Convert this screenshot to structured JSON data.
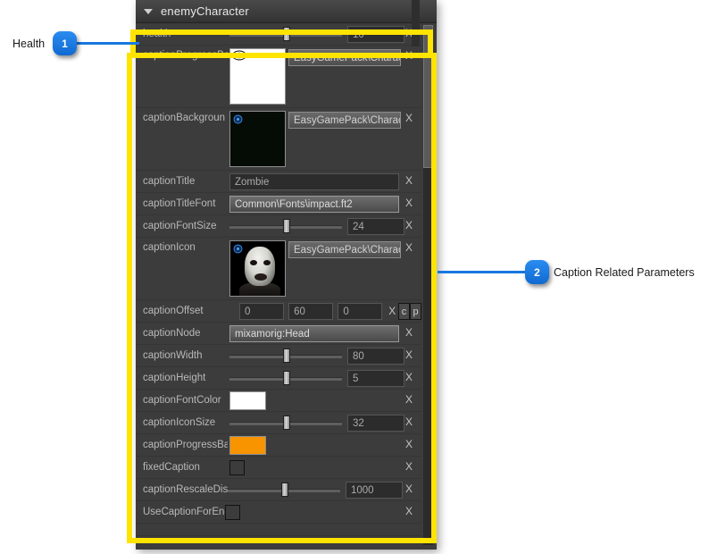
{
  "panel": {
    "title": "enemyCharacter",
    "collapse_icon": "triangle-down-icon",
    "rows": [
      {
        "id": "health",
        "label": "health",
        "type": "slider",
        "value": "10",
        "knob_pct": 48,
        "remove_label": "X"
      },
      {
        "id": "captionProgressBar",
        "label": "captionProgressBa",
        "type": "asset",
        "thumb": "white",
        "overlay_icon": "eye-icon",
        "value": "EasyGamePack\\Charact",
        "remove_label": "X"
      },
      {
        "id": "captionBackground",
        "label": "captionBackgroun",
        "type": "asset",
        "thumb": "black",
        "overlay_icon": "eye-icon",
        "value": "EasyGamePack\\Charact",
        "remove_label": "X"
      },
      {
        "id": "captionTitle",
        "label": "captionTitle",
        "type": "text",
        "value": "Zombie",
        "remove_label": "X"
      },
      {
        "id": "captionTitleFont",
        "label": "captionTitleFont",
        "type": "path",
        "value": "Common\\Fonts\\impact.ft2",
        "remove_label": "X"
      },
      {
        "id": "captionFontSize",
        "label": "captionFontSize",
        "type": "slider",
        "value": "24",
        "knob_pct": 48,
        "remove_label": "X"
      },
      {
        "id": "captionIcon",
        "label": "captionIcon",
        "type": "asset",
        "thumb": "zombie",
        "overlay_icon": "eye-icon",
        "value": "EasyGamePack\\Charact",
        "remove_label": "X"
      },
      {
        "id": "captionOffset",
        "label": "captionOffset",
        "type": "vector3",
        "x": "0",
        "y": "60",
        "z": "0",
        "remove_label": "X",
        "copy_label": "c",
        "paste_label": "p"
      },
      {
        "id": "captionNode",
        "label": "captionNode",
        "type": "selected-text",
        "value": "mixamorig:Head",
        "remove_label": "X"
      },
      {
        "id": "captionWidth",
        "label": "captionWidth",
        "type": "slider",
        "value": "80",
        "knob_pct": 48,
        "remove_label": "X"
      },
      {
        "id": "captionHeight",
        "label": "captionHeight",
        "type": "slider",
        "value": "5",
        "knob_pct": 48,
        "remove_label": "X"
      },
      {
        "id": "captionFontColor",
        "label": "captionFontColor",
        "type": "color",
        "color": "#ffffff",
        "remove_label": "X"
      },
      {
        "id": "captionIconSize",
        "label": "captionIconSize",
        "type": "slider",
        "value": "32",
        "knob_pct": 48,
        "remove_label": "X"
      },
      {
        "id": "captionProgressBarColor",
        "label": "captionProgressBa",
        "type": "color",
        "color": "#f79400",
        "remove_label": "X"
      },
      {
        "id": "fixedCaption",
        "label": "fixedCaption",
        "type": "checkbox",
        "checked": false,
        "remove_label": "X"
      },
      {
        "id": "captionRescaleDistance",
        "label": "captionRescaleDis",
        "type": "slider",
        "value": "1000",
        "knob_pct": 48,
        "remove_label": "X"
      },
      {
        "id": "UseCaptionForEnemy",
        "label": "UseCaptionForEne",
        "type": "checkbox",
        "checked": false,
        "remove_label": "X"
      }
    ]
  },
  "annotations": [
    {
      "number": "1",
      "text": "Health",
      "color": "#1878e0"
    },
    {
      "number": "2",
      "text": "Caption Related Parameters",
      "color": "#1878e0"
    }
  ],
  "highlight_color": "#ffe400"
}
